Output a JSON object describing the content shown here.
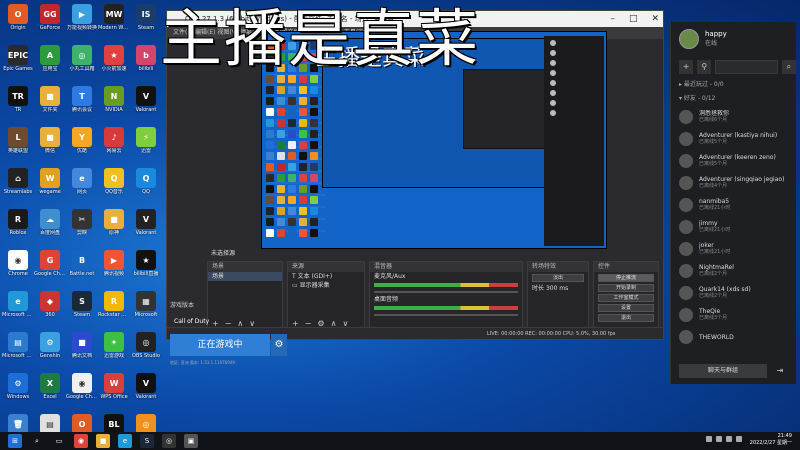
{
  "desktop": {
    "icons": [
      {
        "label": "Origin",
        "color": "#e25b25",
        "glyph": "O"
      },
      {
        "label": "GeForce",
        "color": "#c0272d",
        "glyph": "GG"
      },
      {
        "label": "万能视频转换",
        "color": "#3ba0e0",
        "glyph": "▶"
      },
      {
        "label": "Modern Warfare",
        "color": "#222222",
        "glyph": "MW"
      },
      {
        "label": "Steam",
        "color": "#1b3d6b",
        "glyph": "IS"
      },
      {
        "label": "Epic Games",
        "color": "#2a2a2a",
        "glyph": "EPIC"
      },
      {
        "label": "应用宝",
        "color": "#2c9b3c",
        "glyph": "A"
      },
      {
        "label": "小丸工具箱",
        "color": "#3db26b",
        "glyph": "◎"
      },
      {
        "label": "小火箭加速",
        "color": "#e04040",
        "glyph": "★"
      },
      {
        "label": "bilibili",
        "color": "#d4446b",
        "glyph": "b"
      },
      {
        "label": "TR",
        "color": "#111111",
        "glyph": "TR"
      },
      {
        "label": "文件夹",
        "color": "#e8b03b",
        "glyph": "■"
      },
      {
        "label": "腾讯会议",
        "color": "#2d7be0",
        "glyph": "T"
      },
      {
        "label": "NVIDIA",
        "color": "#6a9c22",
        "glyph": "N"
      },
      {
        "label": "Valorant",
        "color": "#111111",
        "glyph": "V"
      },
      {
        "label": "英雄联盟",
        "color": "#6f4a2e",
        "glyph": "L"
      },
      {
        "label": "微信",
        "color": "#e8b03b",
        "glyph": "■"
      },
      {
        "label": "优酷",
        "color": "#f5a623",
        "glyph": "Y"
      },
      {
        "label": "网易云",
        "color": "#d63a3a",
        "glyph": "♪"
      },
      {
        "label": "迅雷",
        "color": "#7ecf3b",
        "glyph": "⚡"
      },
      {
        "label": "Streamlabs",
        "color": "#222222",
        "glyph": "⌂"
      },
      {
        "label": "wegame",
        "color": "#e0a020",
        "glyph": "W"
      },
      {
        "label": "网页",
        "color": "#4488dd",
        "glyph": "e"
      },
      {
        "label": "QQ音乐",
        "color": "#f0c020",
        "glyph": "Q"
      },
      {
        "label": "QQ",
        "color": "#1a8ae0",
        "glyph": "Q"
      },
      {
        "label": "Roblox",
        "color": "#1a1a1a",
        "glyph": "R"
      },
      {
        "label": "百度网盘",
        "color": "#3e8ed0",
        "glyph": "☁"
      },
      {
        "label": "剪映",
        "color": "#333333",
        "glyph": "✂"
      },
      {
        "label": "原神",
        "color": "#e8b03b",
        "glyph": "■"
      },
      {
        "label": "Valorant",
        "color": "#222222",
        "glyph": "V"
      },
      {
        "label": "Chrome",
        "color": "#ffffff",
        "glyph": "◉"
      },
      {
        "label": "Google Chrome",
        "color": "#dd4433",
        "glyph": "G"
      },
      {
        "label": "Battle.net",
        "color": "#1465c0",
        "glyph": "B"
      },
      {
        "label": "腾讯视频",
        "color": "#ee5533",
        "glyph": "▶"
      },
      {
        "label": "bilibili直播",
        "color": "#111111",
        "glyph": "★"
      },
      {
        "label": "Microsoft Edge",
        "color": "#1f9ad6",
        "glyph": "e"
      },
      {
        "label": "360",
        "color": "#cc3333",
        "glyph": "◆"
      },
      {
        "label": "Steam",
        "color": "#1b2838",
        "glyph": "S"
      },
      {
        "label": "Rockstar Games",
        "color": "#f5b800",
        "glyph": "R"
      },
      {
        "label": "Microsoft",
        "color": "#333333",
        "glyph": "▦"
      },
      {
        "label": "Microsoft Store",
        "color": "#2a7ad0",
        "glyph": "▤"
      },
      {
        "label": "Genshin",
        "color": "#3aa0e0",
        "glyph": "⚙"
      },
      {
        "label": "腾讯文档",
        "color": "#2a4ad0",
        "glyph": "■"
      },
      {
        "label": "迅雷游戏",
        "color": "#3ec040",
        "glyph": "✦"
      },
      {
        "label": "OBS Studio",
        "color": "#222222",
        "glyph": "◎"
      },
      {
        "label": "Windows",
        "color": "#1e6ed8",
        "glyph": "⚙"
      },
      {
        "label": "Excel",
        "color": "#1e7b43",
        "glyph": "X"
      },
      {
        "label": "Google Chrome",
        "color": "#f0f0f0",
        "glyph": "◉"
      },
      {
        "label": "WPS Office",
        "color": "#d84040",
        "glyph": "W"
      },
      {
        "label": "Valorant",
        "color": "#111111",
        "glyph": "V"
      },
      {
        "label": "Recycle Bin",
        "color": "#3a80d0",
        "glyph": "🗑"
      },
      {
        "label": "Document",
        "color": "#e0e0e0",
        "glyph": "▤"
      },
      {
        "label": "Origin",
        "color": "#e25b25",
        "glyph": "O"
      },
      {
        "label": "Black Squad",
        "color": "#111111",
        "glyph": "BL"
      },
      {
        "label": "Overwatch",
        "color": "#f09020",
        "glyph": "◎"
      }
    ]
  },
  "overlay": {
    "title": "主播是真菜"
  },
  "obs": {
    "title": "OBS 27.1.3 (64-bit, windows) - 配置文件: 未命名 - 场景: 未命名",
    "menu": "文件(F)  编辑(E)  视图(V)  停靠部件(D)  配置文件(P)  场景集合(S)  工具(T)  帮助(H)",
    "preview_overlay": "主播是真菜",
    "panels": {
      "scenes": {
        "title": "场景",
        "items": [
          "场景"
        ]
      },
      "sources": {
        "title": "来源",
        "items": [
          "文本 (GDI+)",
          "显示器采集"
        ]
      },
      "mixer": {
        "title": "混音器",
        "tracks": [
          "麦克风/Aux",
          "桌面音频"
        ]
      },
      "transitions": {
        "title": "转场特效",
        "mode": "淡出",
        "duration_label": "时长",
        "duration": "300 ms"
      },
      "controls": {
        "title": "控件",
        "buttons": [
          "停止推流",
          "开始录制",
          "工作室模式",
          "设置",
          "退出"
        ]
      }
    },
    "status": "LIVE: 00:00:00    REC: 00:00:00    CPU: 5.0%, 30.00 fps",
    "no_source": "未选择源"
  },
  "launcher": {
    "status": "游戏版本",
    "game_name": "Call of Duty",
    "play_label": "正在游戏中",
    "gear_icon": "gear-icon",
    "version": "地区: 亚洲   版本: 1.53.1.11076949"
  },
  "friends": {
    "username": "happy",
    "status": "在线",
    "sections": {
      "recent": "最近玩过 - 0/0",
      "friends": "好友 - 0/12"
    },
    "list": [
      {
        "name": "洞悉拯救你",
        "sub": "已离线6个月"
      },
      {
        "name": "Adventurer (kastiya nihui)",
        "sub": "已离线5个月"
      },
      {
        "name": "Adventurer (keeren zeno)",
        "sub": "已离线5个月"
      },
      {
        "name": "Adventurer (singqiao jegiao)",
        "sub": "已离线4个月"
      },
      {
        "name": "nanmiba5",
        "sub": "已离线21小时"
      },
      {
        "name": "jimmy",
        "sub": "已离线21小时"
      },
      {
        "name": "joker",
        "sub": "已离线21小时"
      },
      {
        "name": "NightmaRel",
        "sub": "已离线2个月"
      },
      {
        "name": "Quark14 (xds sd)",
        "sub": "已离线2个月"
      },
      {
        "name": "TheQie",
        "sub": "已离线3个月"
      },
      {
        "name": "THEWORLD",
        "sub": ""
      }
    ],
    "chat_button": "聊天与群组"
  },
  "taskbar": {
    "time": "21:49",
    "date": "2022/2/27 星期一"
  }
}
